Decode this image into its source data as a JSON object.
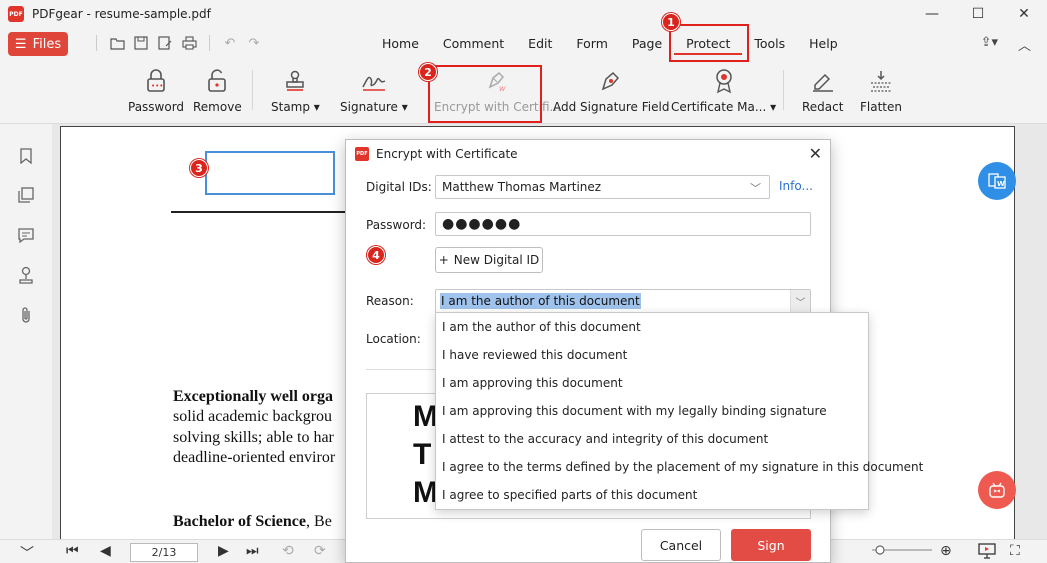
{
  "window": {
    "title": "PDFgear - resume-sample.pdf",
    "logo_text": "PDF",
    "controls": [
      "—",
      "☐",
      "✕"
    ]
  },
  "files_button": "Files",
  "menu_tabs": [
    "Home",
    "Comment",
    "Edit",
    "Form",
    "Page",
    "Protect",
    "Tools",
    "Help"
  ],
  "active_tab": "Protect",
  "ribbon": {
    "password": "Password",
    "remove": "Remove",
    "stamp": "Stamp ▾",
    "signature": "Signature ▾",
    "encrypt": "Encrypt with Certifi...",
    "add_signature_field": "Add Signature Field",
    "certificate_manager": "Certificate Ma... ▾",
    "redact": "Redact",
    "flatten": "Flatten"
  },
  "badges": [
    "1",
    "2",
    "3",
    "4"
  ],
  "document": {
    "line1_bold": "Exceptionally well orga",
    "line2": "solid academic backgrou",
    "line3": "solving skills; able to har",
    "line4": "deadline-oriented enviror",
    "degree_bold": "Bachelor of Science",
    "degree_rest": ", Be"
  },
  "pagination": {
    "current": "2",
    "total": "13",
    "display": "2/13"
  },
  "dialog": {
    "title": "Encrypt with Certificate",
    "digital_ids_label": "Digital IDs:",
    "digital_id_value": "Matthew Thomas Martinez",
    "info_link": "Info...",
    "password_label": "Password:",
    "password_value": "●●●●●●",
    "new_digital_id": "New Digital ID",
    "reason_label": "Reason:",
    "reason_value": "I am the author of this document",
    "location_label": "Location:",
    "preview_letters": [
      "M",
      "T",
      "M"
    ],
    "cancel": "Cancel",
    "sign": "Sign"
  },
  "reason_options": [
    "I am the author of this document",
    "I have reviewed this document",
    "I am approving this document",
    "I am approving this document with my legally binding signature",
    "I attest to the accuracy and integrity of this document",
    "I agree to the terms defined by the placement of my signature in this document",
    "I agree to specified parts of this document"
  ],
  "colors": {
    "accent": "#e0352b",
    "highlight": "#e0201c",
    "link": "#2a6fd6",
    "sign_button": "#e34b45",
    "selection": "#9fc3ec"
  }
}
